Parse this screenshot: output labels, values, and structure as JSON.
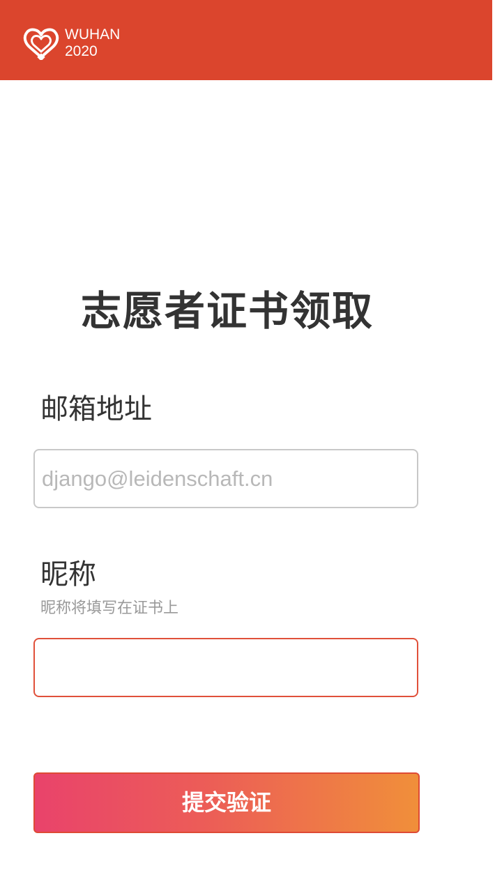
{
  "header": {
    "logo_line1": "WUHAN",
    "logo_line2": "2020",
    "logo_icon": "heart-logo-icon",
    "background": "#DB452D"
  },
  "page": {
    "title": "志愿者证书领取"
  },
  "form": {
    "email": {
      "label": "邮箱地址",
      "placeholder": "django@leidenschaft.cn",
      "value": ""
    },
    "nickname": {
      "label": "昵称",
      "hint": "昵称将填写在证书上",
      "placeholder": "",
      "value": ""
    },
    "submit_label": "提交验证"
  },
  "colors": {
    "accent": "#DB452D",
    "button_gradient_start": "#E9436B",
    "button_gradient_end": "#F08F3A",
    "focused_border": "#E0503A"
  }
}
